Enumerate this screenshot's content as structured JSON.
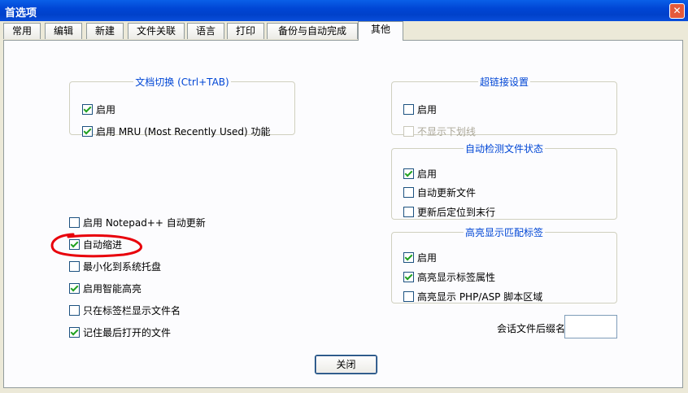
{
  "window": {
    "title": "首选项",
    "close_glyph": "✕"
  },
  "tabs": [
    "常用",
    "编辑",
    "新建",
    "文件关联",
    "语言",
    "打印",
    "备份与自动完成",
    "其他"
  ],
  "active_tab": "其他",
  "doc_switch": {
    "legend": "文档切换 (Ctrl+TAB)",
    "items": [
      {
        "label": "启用",
        "checked": true
      },
      {
        "label": "启用 MRU (Most Recently Used) 功能",
        "checked": true
      }
    ]
  },
  "hyperlink": {
    "legend": "超链接设置",
    "items": [
      {
        "label": "启用",
        "checked": false
      },
      {
        "label": "不显示下划线",
        "checked": false,
        "disabled": true
      }
    ]
  },
  "auto_detect": {
    "legend": "自动检测文件状态",
    "items": [
      {
        "label": "启用",
        "checked": true
      },
      {
        "label": "自动更新文件",
        "checked": false
      },
      {
        "label": "更新后定位到末行",
        "checked": false
      }
    ]
  },
  "highlight_tags": {
    "legend": "高亮显示匹配标签",
    "items": [
      {
        "label": "启用",
        "checked": true
      },
      {
        "label": "高亮显示标签属性",
        "checked": true
      },
      {
        "label": "高亮显示 PHP/ASP 脚本区域",
        "checked": false
      }
    ]
  },
  "misc": {
    "items": [
      {
        "label": "启用 Notepad++ 自动更新",
        "checked": false
      },
      {
        "label": "自动缩进",
        "checked": true
      },
      {
        "label": "最小化到系统托盘",
        "checked": false
      },
      {
        "label": "启用智能高亮",
        "checked": true
      },
      {
        "label": "只在标签栏显示文件名",
        "checked": false
      },
      {
        "label": "记住最后打开的文件",
        "checked": true
      }
    ]
  },
  "session_ext": {
    "label": "会话文件后缀名",
    "value": ""
  },
  "close_button": "关闭",
  "colors": {
    "accent": "#0046D5",
    "annotation": "#E8000B"
  }
}
